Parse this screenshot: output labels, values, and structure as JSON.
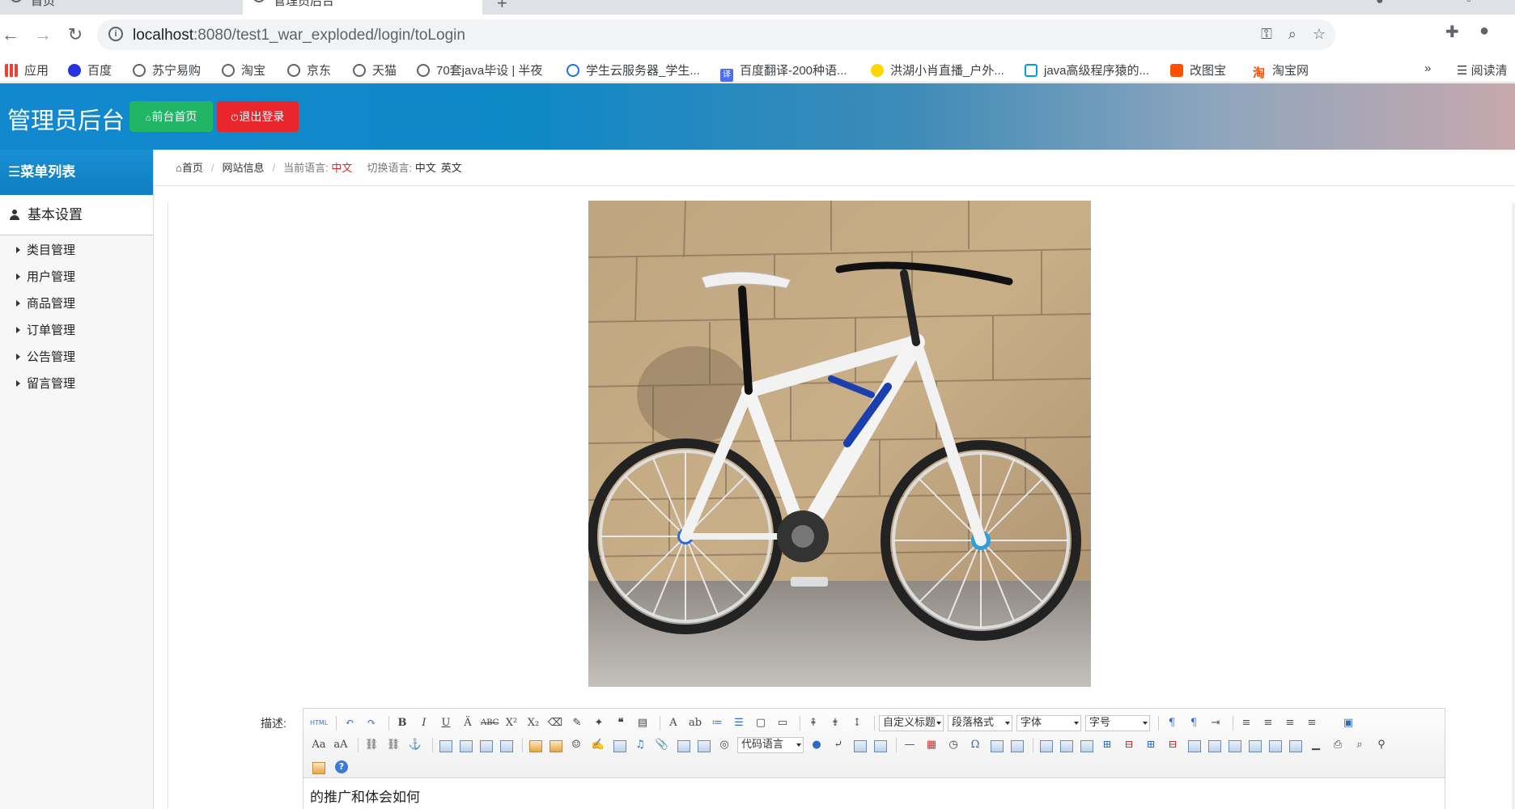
{
  "browser": {
    "tabs": [
      {
        "label": "首页"
      },
      {
        "label": "管理员后台"
      }
    ],
    "url": {
      "host": "localhost",
      "path": ":8080/test1_war_exploded/login/toLogin"
    },
    "bookmarks": [
      {
        "label": "应用",
        "icon": "apps-grid-icon"
      },
      {
        "label": "百度",
        "icon": "baidu-paw-icon"
      },
      {
        "label": "苏宁易购",
        "icon": "globe-icon"
      },
      {
        "label": "淘宝",
        "icon": "globe-icon"
      },
      {
        "label": "京东",
        "icon": "globe-icon"
      },
      {
        "label": "天猫",
        "icon": "globe-icon"
      },
      {
        "label": "70套java毕设 | 半夜",
        "icon": "globe-icon"
      },
      {
        "label": "学生云服务器_学生...",
        "icon": "cloud-icon"
      },
      {
        "label": "百度翻译-200种语...",
        "icon": "fanyi-icon"
      },
      {
        "label": "洪湖小肖直播_户外...",
        "icon": "bird-icon"
      },
      {
        "label": "java高级程序猿的...",
        "icon": "bilibili-tv-icon"
      },
      {
        "label": "改图宝",
        "icon": "gaitubao-icon"
      },
      {
        "label": "淘宝网",
        "icon": "taobao-icon"
      }
    ],
    "bookmarks_more": "»",
    "reading_list": "阅读清"
  },
  "header": {
    "title": "管理员后台",
    "home_button": "前台首页",
    "logout_button": "退出登录",
    "colors": {
      "home": "#21b665",
      "logout": "#e8262b"
    }
  },
  "sidebar": {
    "menu_title": "菜单列表",
    "group_label": "基本设置",
    "items": [
      {
        "label": "类目管理"
      },
      {
        "label": "用户管理"
      },
      {
        "label": "商品管理"
      },
      {
        "label": "订单管理"
      },
      {
        "label": "公告管理"
      },
      {
        "label": "留言管理"
      }
    ]
  },
  "breadcrumb": {
    "home": "首页",
    "section": "网站信息",
    "current_lang_label": "当前语言:",
    "current_lang": "中文",
    "switch_label": "切换语言:",
    "lang_options": [
      "中文",
      "英文"
    ]
  },
  "form": {
    "image_alt": "white mountain bicycle against stone wall",
    "desc_label": "描述:",
    "editor_content": "的推广和体会如何",
    "toolbar_selects": {
      "custom_title": "自定义标题",
      "paragraph": "段落格式",
      "font": "字体",
      "font_size": "字号",
      "code_lang": "代码语言"
    }
  }
}
